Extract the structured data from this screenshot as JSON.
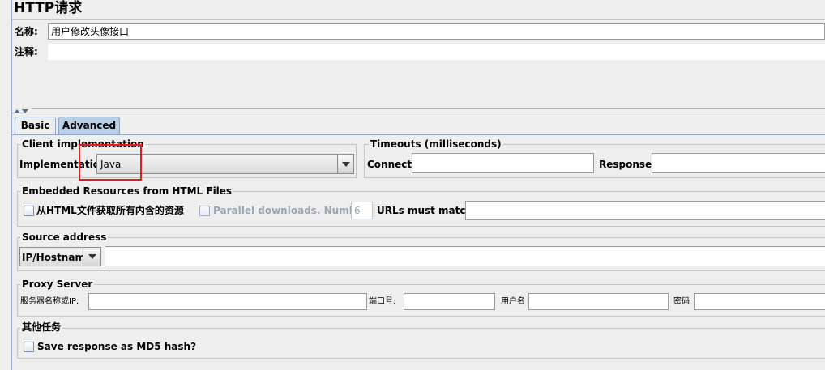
{
  "page_title": "HTTP请求",
  "name_label": "名称:",
  "name_value": "用户修改头像接口",
  "comment_label": "注释:",
  "comment_value": "",
  "tabs": [
    {
      "label": "Basic"
    },
    {
      "label": "Advanced"
    }
  ],
  "client_impl": {
    "legend": "Client implementation",
    "label": "Implementation:",
    "value": "Java"
  },
  "timeouts": {
    "legend": "Timeouts (milliseconds)",
    "connect_label": "Connect:",
    "response_label": "Response:"
  },
  "embedded": {
    "legend": "Embedded Resources from HTML Files",
    "retrieve_label": "从HTML文件获取所有内含的资源",
    "parallel_label": "Parallel downloads. Number:",
    "parallel_value": "6",
    "urls_label": "URLs must match:"
  },
  "source": {
    "legend": "Source address",
    "type_value": "IP/Hostname"
  },
  "proxy": {
    "legend": "Proxy Server",
    "server_label": "服务器名称或IP:",
    "port_label": "端口号:",
    "user_label": "用户名",
    "password_label": "密码"
  },
  "other": {
    "legend": "其他任务",
    "md5_label": "Save response as MD5 hash?"
  },
  "colors": {
    "highlight": "#e02020",
    "active_tab": "#b8cfe5",
    "border_blue": "#8da6c4"
  }
}
